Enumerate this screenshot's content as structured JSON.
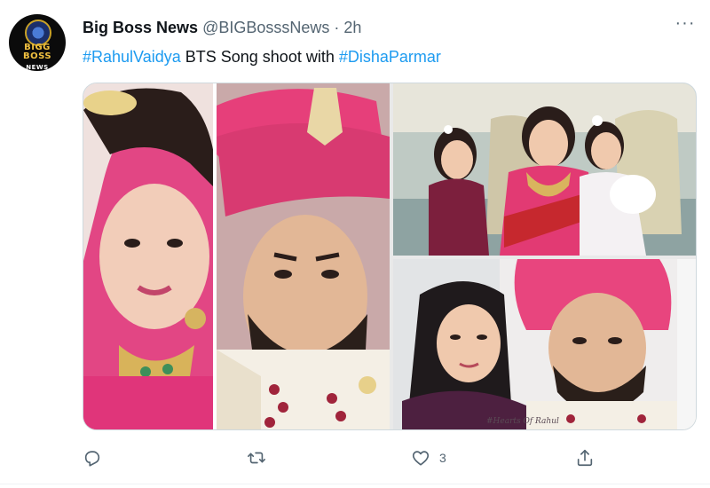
{
  "tweet": {
    "display_name": "Big Boss News",
    "handle": "@BIGBosssNews",
    "separator": "·",
    "time": "2h",
    "more_label": "···",
    "text_parts": {
      "hashtag1": "#RahulVaidya",
      "middle": " BTS Song shoot with ",
      "hashtag2": "#DishaParmar"
    }
  },
  "avatar": {
    "logo_line1": "BIGG BOSS",
    "logo_line2": "NEWS"
  },
  "media": {
    "watermark": "#Hearts Of Rahul"
  },
  "actions": {
    "reply_count": "",
    "retweet_count": "",
    "like_count": "3",
    "share_count": ""
  },
  "colors": {
    "accent": "#1d9bf0",
    "muted": "#536471"
  },
  "icons": [
    "reply-icon",
    "retweet-icon",
    "heart-icon",
    "share-icon",
    "more-icon"
  ]
}
